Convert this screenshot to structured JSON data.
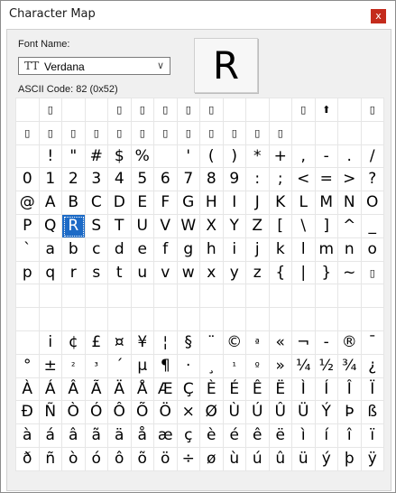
{
  "window": {
    "title": "Character Map",
    "close_label": "x"
  },
  "font": {
    "label": "Font Name:",
    "value": "Verdana",
    "icon_glyph": "TT",
    "icon": "truetype-font-icon"
  },
  "ascii_code": "ASCII Code: 82 (0x52)",
  "preview_char": "R",
  "colors": {
    "selection": "#1c6ac6",
    "close_button": "#c42b1c",
    "panel": "#f0f0f0"
  },
  "grid": {
    "rows": [
      [
        " ",
        "▯",
        " ",
        " ",
        "▯",
        "▯",
        "▯",
        "▯",
        "▯",
        " ",
        " ",
        " ",
        "▯",
        "⬆",
        " ",
        "▯"
      ],
      [
        "▯",
        "▯",
        "▯",
        "▯",
        "▯",
        "▯",
        "▯",
        "▯",
        "▯",
        "▯",
        "▯",
        "▯",
        " ",
        " ",
        " ",
        " "
      ],
      [
        " ",
        "!",
        "\"",
        "#",
        "$",
        "%",
        " ",
        "'",
        "(",
        ")",
        "*",
        "+",
        ",",
        "-",
        ".",
        "/"
      ],
      [
        "0",
        "1",
        "2",
        "3",
        "4",
        "5",
        "6",
        "7",
        "8",
        "9",
        ":",
        ";",
        "<",
        "=",
        ">",
        "?"
      ],
      [
        "@",
        "A",
        "B",
        "C",
        "D",
        "E",
        "F",
        "G",
        "H",
        "I",
        "J",
        "K",
        "L",
        "M",
        "N",
        "O"
      ],
      [
        "P",
        "Q",
        "R",
        "S",
        "T",
        "U",
        "V",
        "W",
        "X",
        "Y",
        "Z",
        "[",
        "\\",
        "]",
        "^",
        "_"
      ],
      [
        "`",
        "a",
        "b",
        "c",
        "d",
        "e",
        "f",
        "g",
        "h",
        "i",
        "j",
        "k",
        "l",
        "m",
        "n",
        "o"
      ],
      [
        "p",
        "q",
        "r",
        "s",
        "t",
        "u",
        "v",
        "w",
        "x",
        "y",
        "z",
        "{",
        "|",
        "}",
        "~",
        "▯"
      ],
      [
        " ",
        " ",
        " ",
        " ",
        " ",
        " ",
        " ",
        " ",
        " ",
        " ",
        " ",
        " ",
        " ",
        " ",
        " ",
        " "
      ],
      [
        " ",
        " ",
        " ",
        " ",
        " ",
        " ",
        " ",
        " ",
        " ",
        " ",
        " ",
        " ",
        " ",
        " ",
        " ",
        " "
      ],
      [
        " ",
        "i",
        "¢",
        "£",
        "¤",
        "¥",
        "¦",
        "§",
        "¨",
        "©",
        "ª",
        "«",
        "¬",
        "-",
        "®",
        "¯"
      ],
      [
        "°",
        "±",
        "²",
        "³",
        "´",
        "µ",
        "¶",
        "·",
        "¸",
        "¹",
        "º",
        "»",
        "¼",
        "½",
        "¾",
        "¿"
      ],
      [
        "À",
        "Á",
        "Â",
        "Ã",
        "Ä",
        "Å",
        "Æ",
        "Ç",
        "È",
        "É",
        "Ê",
        "Ë",
        "Ì",
        "Í",
        "Î",
        "Ï"
      ],
      [
        "Ð",
        "Ñ",
        "Ò",
        "Ó",
        "Ô",
        "Õ",
        "Ö",
        "×",
        "Ø",
        "Ù",
        "Ú",
        "Û",
        "Ü",
        "Ý",
        "Þ",
        "ß"
      ],
      [
        "à",
        "á",
        "â",
        "ã",
        "ä",
        "å",
        "æ",
        "ç",
        "è",
        "é",
        "ê",
        "ë",
        "ì",
        "í",
        "î",
        "ï"
      ],
      [
        "ð",
        "ñ",
        "ò",
        "ó",
        "ô",
        "õ",
        "ö",
        "÷",
        "ø",
        "ù",
        "ú",
        "û",
        "ü",
        "ý",
        "þ",
        "ÿ"
      ]
    ],
    "selected": "R"
  }
}
